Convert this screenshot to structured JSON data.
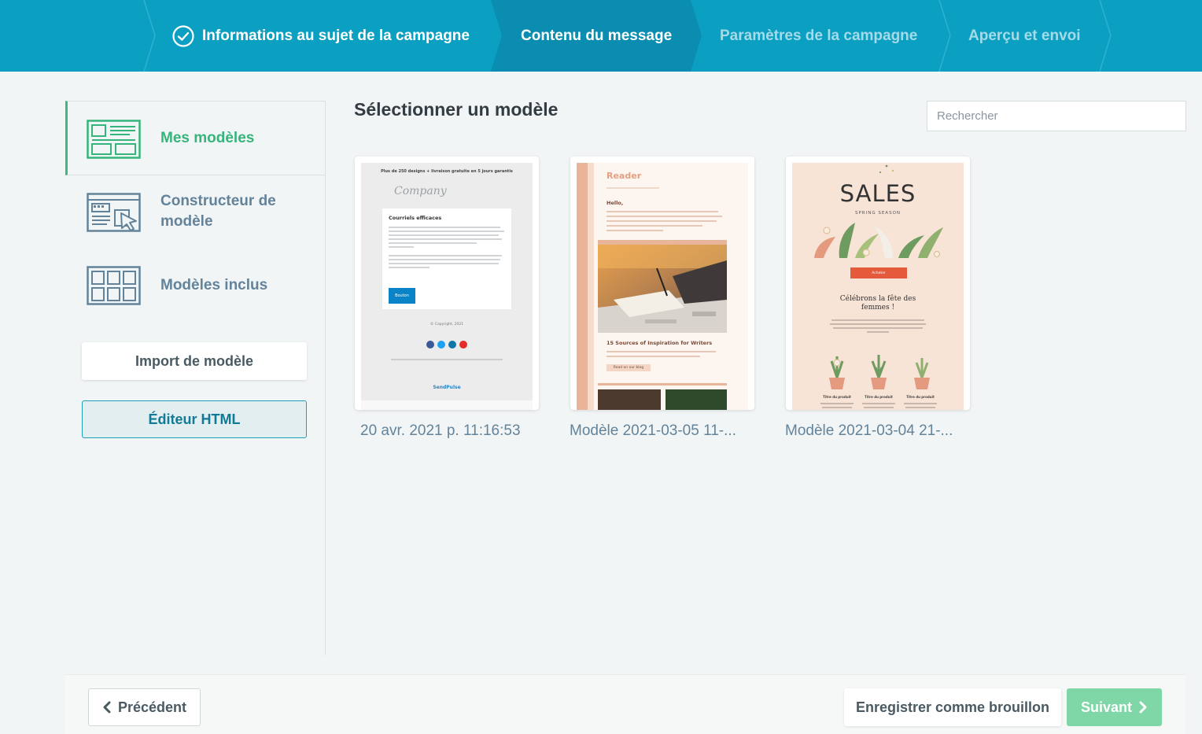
{
  "stepper": {
    "steps": [
      {
        "label": "Informations au sujet de la campagne",
        "state": "done"
      },
      {
        "label": "Contenu du message",
        "state": "current"
      },
      {
        "label": "Paramètres de la campagne",
        "state": "future"
      },
      {
        "label": "Aperçu et envoi",
        "state": "future"
      }
    ]
  },
  "sidebar": {
    "items": [
      {
        "label": "Mes modèles",
        "icon": "my-templates-icon"
      },
      {
        "label": "Constructeur de modèle",
        "icon": "template-builder-icon"
      },
      {
        "label": "Modèles inclus",
        "icon": "included-templates-icon"
      }
    ],
    "import_label": "Import de modèle",
    "html_editor_label": "Éditeur HTML"
  },
  "main": {
    "title": "Sélectionner un modèle",
    "search_placeholder": "Rechercher",
    "templates": [
      {
        "caption": "20 avr. 2021 p. 11:16:53",
        "preview": {
          "header": "Plus de 250 designs + livraison gratuite en 5 jours garantis",
          "logo": "Company",
          "heading": "Courriels efficaces",
          "button": "Bouton",
          "copyright": "© Copyright, 2021",
          "brand": "SendPulse"
        }
      },
      {
        "caption": "Modèle 2021-03-05 11-...",
        "preview": {
          "brand": "Reader",
          "greeting": "Hello,",
          "article": "15 Sources of Inspiration for Writers",
          "cta": "Read on our blog"
        }
      },
      {
        "caption": "Modèle 2021-03-04 21-...",
        "preview": {
          "headline": "SALES",
          "subhead": "SPRING SEASON",
          "cta": "Acheter",
          "tagline": "Célébrons la fête des femmes !",
          "product_title": "Titre du produit"
        }
      }
    ]
  },
  "footer": {
    "prev_label": "Précédent",
    "draft_label": "Enregistrer comme brouillon",
    "next_label": "Suivant"
  },
  "colors": {
    "stepper_bg": "#0b9fc2",
    "stepper_active_bg": "#0a8db0",
    "accent_green": "#35b57b",
    "next_button": "#7fd6a7"
  }
}
